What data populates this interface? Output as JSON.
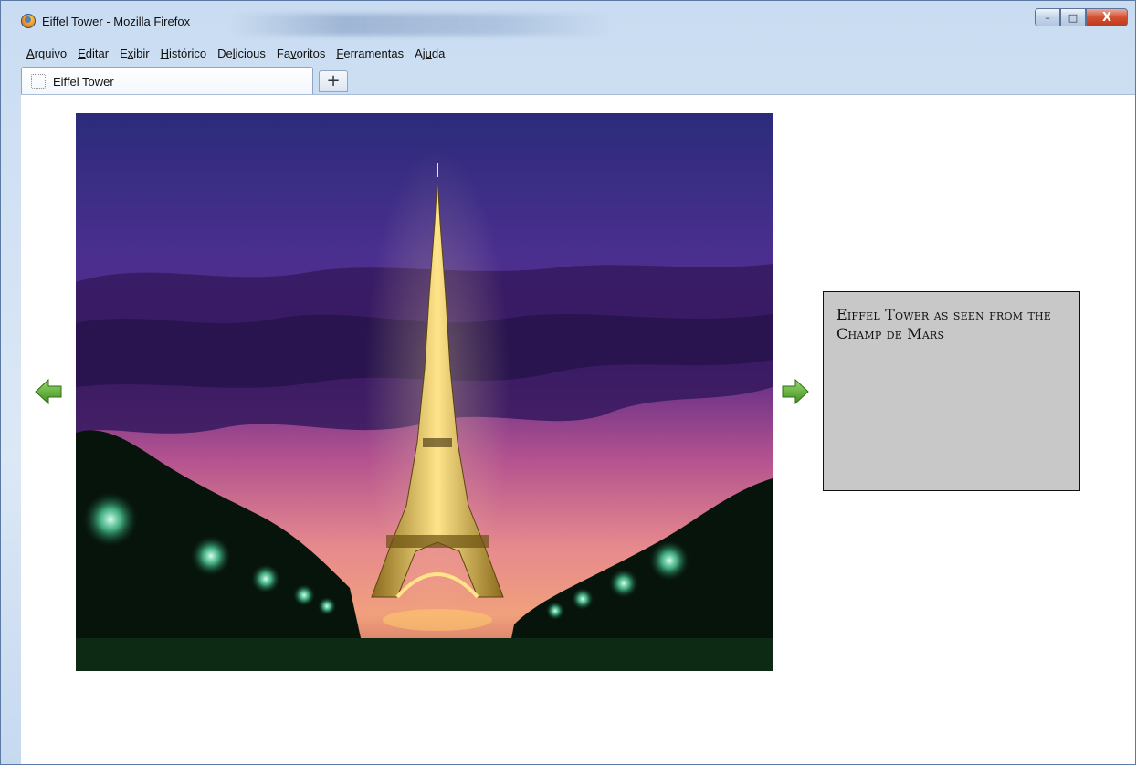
{
  "window": {
    "title": "Eiffel Tower - Mozilla Firefox",
    "buttons": {
      "minimize": "–",
      "maximize": "□",
      "close": "X"
    }
  },
  "menubar": {
    "items": [
      {
        "label": "Arquivo",
        "mnemonic": "A"
      },
      {
        "label": "Editar",
        "mnemonic": "E"
      },
      {
        "label": "Exibir",
        "mnemonic": "x"
      },
      {
        "label": "Histórico",
        "mnemonic": "H"
      },
      {
        "label": "Delicious",
        "mnemonic": "l"
      },
      {
        "label": "Favoritos",
        "mnemonic": "v"
      },
      {
        "label": "Ferramentas",
        "mnemonic": "F"
      },
      {
        "label": "Ajuda",
        "mnemonic": "u"
      }
    ]
  },
  "tabs": [
    {
      "label": "Eiffel Tower",
      "icon": "blank-page-icon",
      "active": true
    }
  ],
  "newtab_label": "+",
  "page": {
    "caption": "Eiffel Tower as seen from the Champ de Mars",
    "prev_arrow": "arrow-left-icon",
    "next_arrow": "arrow-right-icon",
    "arrow_color": "#5aa832"
  }
}
